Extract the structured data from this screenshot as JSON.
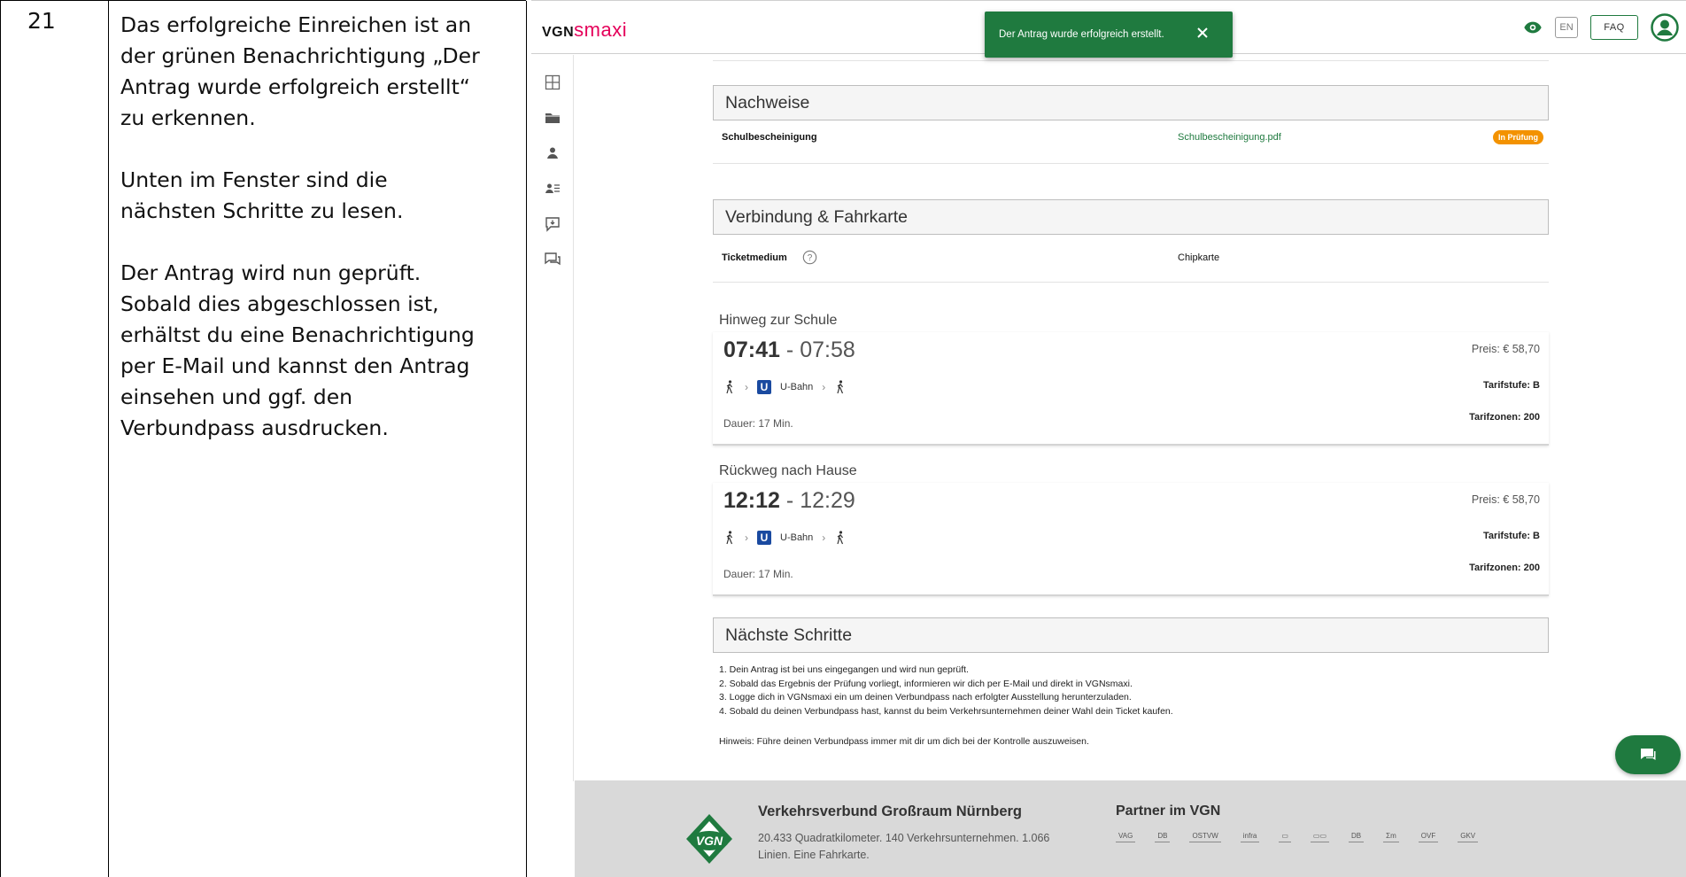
{
  "doc": {
    "step_number": "21",
    "paragraphs": [
      "Das erfolgreiche Einreichen ist an\nder grünen Benachrichtigung „Der\nAntrag wurde erfolgreich erstellt“\nzu erkennen.",
      "Unten im Fenster sind die\nnächsten Schritte zu lesen.",
      "Der Antrag wird nun geprüft.\nSobald dies abgeschlossen ist,\nerhältst du eine Benachrichtigung\nper E-Mail und kannst den Antrag\neinsehen und ggf. den\nVerbundpass ausdrucken."
    ]
  },
  "header": {
    "logo_vgn": "VGN",
    "logo_smaxi": "smaxi",
    "lang_label": "EN",
    "faq_label": "FAQ"
  },
  "toast": {
    "message": "Der Antrag wurde erfolgreich erstellt."
  },
  "nachweise": {
    "title": "Nachweise",
    "label": "Schulbescheinigung",
    "file": "Schulbescheinigung.pdf",
    "status": "In Prüfung"
  },
  "verbindung": {
    "title": "Verbindung & Fahrkarte",
    "ticket_label": "Ticketmedium",
    "ticket_value": "Chipkarte"
  },
  "trips": [
    {
      "title": "Hinweg zur Schule",
      "depart": "07:41",
      "arrive": "07:58",
      "price": "Preis: € 58,70",
      "tarif": "Tarifstufe: B",
      "zones": "Tarifzonen: 200",
      "mode": "U-Bahn",
      "duration": "Dauer: 17 Min."
    },
    {
      "title": "Rückweg nach Hause",
      "depart": "12:12",
      "arrive": "12:29",
      "price": "Preis: € 58,70",
      "tarif": "Tarifstufe: B",
      "zones": "Tarifzonen: 200",
      "mode": "U-Bahn",
      "duration": "Dauer: 17 Min."
    }
  ],
  "next_steps": {
    "title": "Nächste Schritte",
    "items": [
      "1. Dein Antrag ist bei uns eingegangen und wird nun geprüft.",
      "2. Sobald das Ergebnis der Prüfung vorliegt, informieren wir dich per E-Mail und direkt in VGNsmaxi.",
      "3. Logge dich in VGNsmaxi ein um deinen Verbundpass nach erfolgter Ausstellung herunterzuladen.",
      "4. Sobald du deinen Verbundpass hast, kannst du beim Verkehrsunternehmen deiner Wahl dein Ticket kaufen."
    ],
    "hint": "Hinweis: Führe deinen Verbundpass immer mit dir um dich bei der Kontrolle auszuweisen."
  },
  "footer": {
    "logo_text": "VGN",
    "title": "Verkehrsverbund Großraum Nürnberg",
    "text": "20.433 Quadratkilometer. 140 Verkehrsunternehmen. 1.066 Linien. Eine Fahrkarte.",
    "partner_title": "Partner im VGN",
    "partners": [
      "VAG",
      "DB",
      "OSTVW",
      "infra",
      "▭",
      "▭▭",
      "DB",
      "Ʃm",
      "OVF",
      "GKV"
    ]
  },
  "colors": {
    "brand_green": "#1f7a3f",
    "brand_pink": "#e5005a",
    "badge_orange": "#f39200",
    "ubahn_blue": "#1a4aa0"
  }
}
